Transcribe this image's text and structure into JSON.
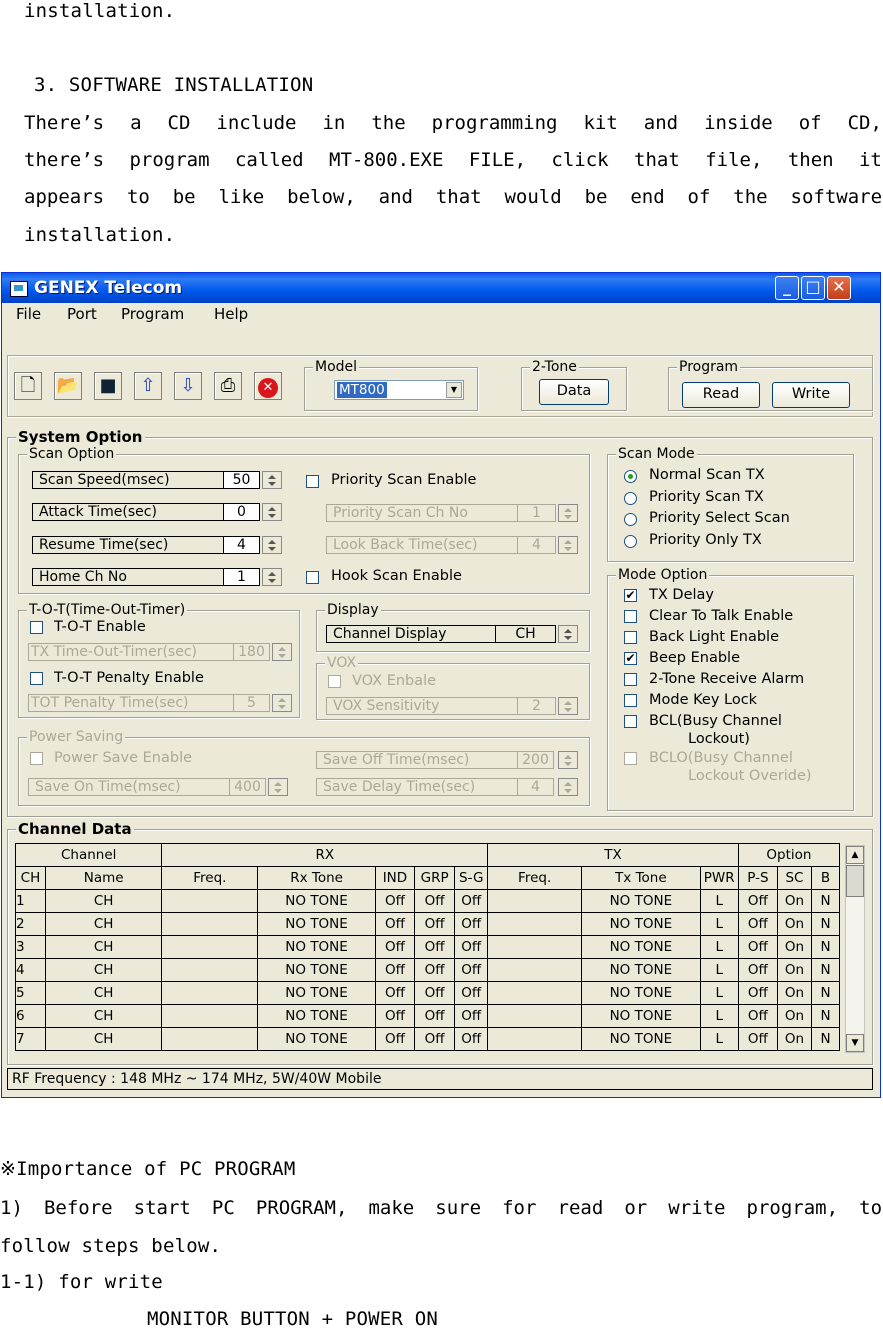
{
  "doc": {
    "line1": "installation.",
    "heading": "3. SOFTWARE INSTALLATION",
    "para": [
      [
        "There’s",
        "a",
        "CD",
        "include",
        "in",
        "the",
        "programming",
        "kit",
        "and",
        "inside",
        "of",
        "CD,"
      ],
      [
        "there’s",
        "program",
        "called",
        "MT-800.EXE",
        "FILE,",
        "click",
        "that",
        "file,",
        "then",
        "it"
      ],
      [
        "appears",
        "to",
        "be",
        "like",
        "below,",
        "and",
        "that",
        "would",
        "be",
        "end",
        "of",
        "the",
        "software"
      ]
    ],
    "para_last": "installation.",
    "note": "※Importance of PC PROGRAM",
    "step1a": [
      "1)",
      "Before",
      "start",
      "PC",
      "PROGRAM,",
      "make",
      "sure",
      "for",
      "read",
      "or",
      "write",
      "program,",
      "to"
    ],
    "step1b": "follow steps below.",
    "step11": "1-1) for write",
    "step11_detail": "MONITOR BUTTON + POWER ON"
  },
  "window": {
    "title": "GENEX Telecom",
    "menu": [
      "File",
      "Port",
      "Program",
      "Help"
    ],
    "model_label": "Model",
    "model_value": "MT800",
    "two_tone_label": "2-Tone",
    "data_button": "Data",
    "program_label": "Program",
    "read_button": "Read",
    "write_button": "Write",
    "system_option": "System Option",
    "scan_option": "Scan Option",
    "scan_speed_label": "Scan Speed(msec)",
    "scan_speed": "50",
    "attack_time_label": "Attack Time(sec)",
    "attack_time": "0",
    "resume_time_label": "Resume Time(sec)",
    "resume_time": "4",
    "home_ch_label": "Home Ch No",
    "home_ch": "1",
    "priority_scan_enable": "Priority Scan Enable",
    "priority_scan_ch_label": "Priority Scan Ch No",
    "priority_scan_ch": "1",
    "look_back_label": "Look Back Time(sec)",
    "look_back": "4",
    "hook_scan_enable": "Hook Scan Enable",
    "scan_mode": "Scan Mode",
    "scan_modes": [
      "Normal Scan TX",
      "Priority Scan TX",
      "Priority Select Scan",
      "Priority Only TX"
    ],
    "mode_option": "Mode Option",
    "mode_options": [
      {
        "label": "TX Delay",
        "checked": "✔"
      },
      {
        "label": "Clear To Talk Enable",
        "checked": ""
      },
      {
        "label": "Back Light Enable",
        "checked": ""
      },
      {
        "label": "Beep Enable",
        "checked": "✔"
      },
      {
        "label": "2-Tone Receive Alarm",
        "checked": ""
      },
      {
        "label": "Mode Key Lock",
        "checked": ""
      }
    ],
    "bcl_line1": "BCL(Busy Channel",
    "bcl_line2": "Lockout)",
    "bclo_line1": "BCLO(Busy Channel",
    "bclo_line2": "Lockout Overide)",
    "tot_group": "T-O-T(Time-Out-Timer)",
    "tot_enable": "T-O-T Enable",
    "tx_tot_label": "TX Time-Out-Timer(sec)",
    "tx_tot": "180",
    "tot_penalty_enable": "T-O-T Penalty Enable",
    "tot_penalty_label": "TOT Penalty Time(sec)",
    "tot_penalty": "5",
    "display_group": "Display",
    "channel_display_label": "Channel Display",
    "channel_display": "CH",
    "vox_group": "VOX",
    "vox_enable": "VOX Enbale",
    "vox_sens_label": "VOX Sensitivity",
    "vox_sens": "2",
    "power_saving": "Power Saving",
    "power_save_enable": "Power Save Enable",
    "save_on_label": "Save On Time(msec)",
    "save_on": "400",
    "save_off_label": "Save Off Time(msec)",
    "save_off": "200",
    "save_delay_label": "Save Delay Time(sec)",
    "save_delay": "4",
    "channel_data": "Channel Data",
    "table_groups": [
      "Channel",
      "RX",
      "TX",
      "Option"
    ],
    "table_headers": [
      "CH",
      "Name",
      "Freq.",
      "Rx Tone",
      "IND",
      "GRP",
      "S-G",
      "Freq.",
      "Tx Tone",
      "PWR",
      "P-S",
      "SC",
      "B"
    ],
    "rows": [
      [
        "1",
        "CH",
        "",
        "NO TONE",
        "Off",
        "Off",
        "Off",
        "",
        "NO TONE",
        "L",
        "Off",
        "On",
        "N"
      ],
      [
        "2",
        "CH",
        "",
        "NO TONE",
        "Off",
        "Off",
        "Off",
        "",
        "NO TONE",
        "L",
        "Off",
        "On",
        "N"
      ],
      [
        "3",
        "CH",
        "",
        "NO TONE",
        "Off",
        "Off",
        "Off",
        "",
        "NO TONE",
        "L",
        "Off",
        "On",
        "N"
      ],
      [
        "4",
        "CH",
        "",
        "NO TONE",
        "Off",
        "Off",
        "Off",
        "",
        "NO TONE",
        "L",
        "Off",
        "On",
        "N"
      ],
      [
        "5",
        "CH",
        "",
        "NO TONE",
        "Off",
        "Off",
        "Off",
        "",
        "NO TONE",
        "L",
        "Off",
        "On",
        "N"
      ],
      [
        "6",
        "CH",
        "",
        "NO TONE",
        "Off",
        "Off",
        "Off",
        "",
        "NO TONE",
        "L",
        "Off",
        "On",
        "N"
      ],
      [
        "7",
        "CH",
        "",
        "NO TONE",
        "Off",
        "Off",
        "Off",
        "",
        "NO TONE",
        "L",
        "Off",
        "On",
        "N"
      ]
    ],
    "status": "RF Frequency : 148 MHz ~ 174 MHz, 5W/40W Mobile"
  }
}
